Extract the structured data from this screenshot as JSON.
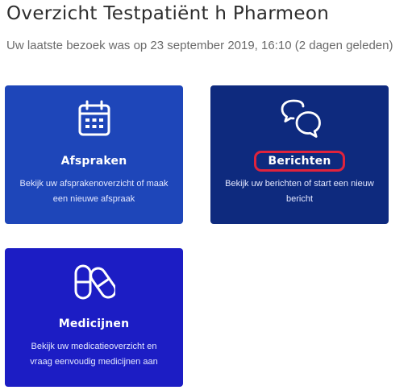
{
  "page": {
    "title": "Overzicht Testpatiënt h Pharmeon",
    "last_visit": "Uw laatste bezoek was op 23 september 2019, 16:10 (2 dagen geleden)"
  },
  "colors": {
    "tile_afspraken": "#1e46b9",
    "tile_berichten": "#0e2a7e",
    "tile_medicijnen": "#1c1dc4",
    "highlight": "#e0233c"
  },
  "tiles": [
    {
      "icon": "calendar-icon",
      "title": "Afspraken",
      "description": "Bekijk uw afsprakenoverzicht of maak een nieuwe afspraak"
    },
    {
      "icon": "chat-bubbles-icon",
      "title": "Berichten",
      "description": "Bekijk uw berichten of start een nieuw bericht",
      "highlighted": true
    },
    {
      "icon": "pills-icon",
      "title": "Medicijnen",
      "description": "Bekijk uw medicatieoverzicht en vraag eenvoudig medicijnen aan"
    }
  ]
}
